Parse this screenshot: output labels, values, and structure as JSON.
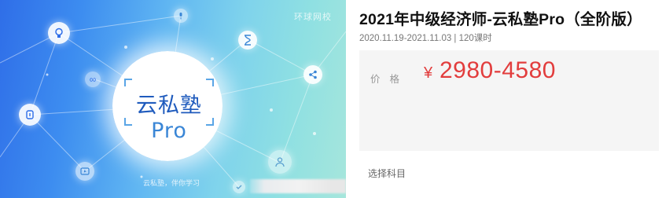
{
  "banner": {
    "watermark_top": "环球网校",
    "logo_main": "云私塾",
    "logo_pro": "Pro",
    "logo_sub": "云私塾，伴你学习",
    "icons": [
      "lightbulb-icon",
      "microphone-icon",
      "hourglass-icon",
      "share-icon",
      "infinity-icon",
      "fingerprint-icon",
      "play-icon",
      "person-icon",
      "check-icon"
    ]
  },
  "course": {
    "title": "2021年中级经济师-云私塾Pro（全阶版）",
    "meta": "2020.11.19-2021.11.03 | 120课时",
    "price_label": "价格",
    "price_currency": "¥",
    "price_value": "2980-4580",
    "select_subject": "选择科目"
  },
  "colors": {
    "price": "#e23d3d",
    "banner_start": "#2f6ee8",
    "banner_end": "#a6e6dc",
    "logo": "#1f5bbd"
  }
}
